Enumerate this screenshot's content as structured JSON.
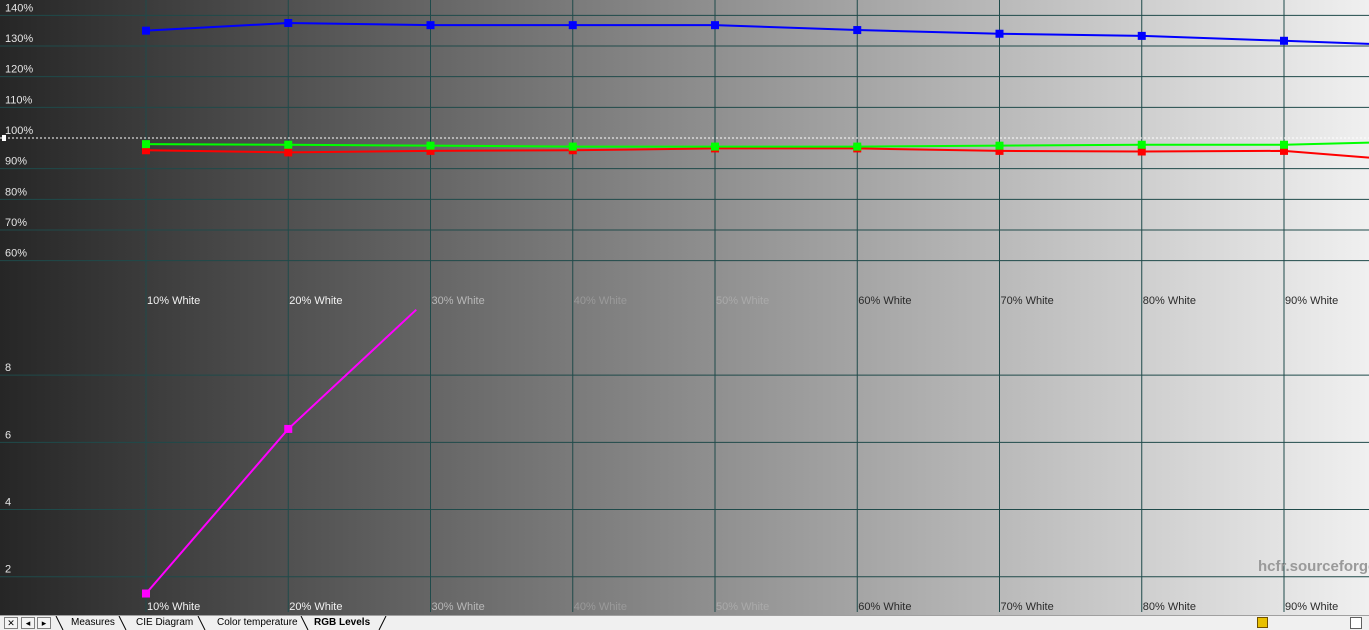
{
  "chart_data": {
    "type": "line",
    "categories": [
      "10% White",
      "20% White",
      "30% White",
      "40% White",
      "50% White",
      "60% White",
      "70% White",
      "80% White",
      "90% White"
    ],
    "rgb_levels": {
      "y_ticks": [
        "60%",
        "70%",
        "80%",
        "90%",
        "100%",
        "110%",
        "120%",
        "130%",
        "140%"
      ],
      "y_tick_values": [
        60,
        70,
        80,
        90,
        100,
        110,
        120,
        130,
        140
      ],
      "ylim": [
        55,
        145
      ],
      "reference": 100,
      "series": [
        {
          "color": "#0000ff",
          "values": [
            135,
            137.5,
            136.8,
            136.8,
            136.8,
            135.2,
            134,
            133.3,
            131.7
          ],
          "tail": 130.7
        },
        {
          "color": "#00ff00",
          "values": [
            98,
            97.8,
            97.5,
            97.2,
            97.2,
            97.2,
            97.5,
            97.8,
            97.8
          ],
          "tail": 98.5
        },
        {
          "color": "#ff0000",
          "values": [
            96,
            95.3,
            95.8,
            96,
            96.6,
            96.6,
            95.8,
            95.6,
            95.8
          ],
          "tail": 93.6
        }
      ]
    },
    "delta_e": {
      "y_ticks": [
        "2",
        "4",
        "6",
        "8"
      ],
      "y_tick_values": [
        2,
        4,
        6,
        8
      ],
      "ylim": [
        0.95,
        10
      ],
      "series": [
        {
          "color": "#ff00ff",
          "values": [
            1.5,
            6.4
          ],
          "tail_x": 1.9,
          "tail_y": 9.95
        }
      ]
    }
  },
  "watermark": "hcfr.sourceforge",
  "tabs": {
    "nav": [
      "✕",
      "◂",
      "▸"
    ],
    "items": [
      "Measures",
      "CIE Diagram",
      "Color temperature",
      "RGB Levels"
    ],
    "active_index": 3
  },
  "colors": {
    "grid": "#1f4a4a",
    "gradient": [
      "#262626",
      "#f0f0f0"
    ]
  }
}
